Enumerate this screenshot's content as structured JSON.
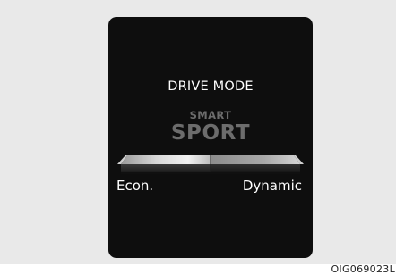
{
  "display": {
    "title": "DRIVE MODE",
    "mode_small": "SMART",
    "mode_large": "SPORT",
    "left_label": "Econ.",
    "right_label": "Dynamic",
    "image_code": "OIG069023L"
  },
  "colors": {
    "screen_bg": "#0e0e0e",
    "frame_bg": "#e9e9e9",
    "text_primary": "#ffffff",
    "text_dim": "#6c6c6c"
  }
}
